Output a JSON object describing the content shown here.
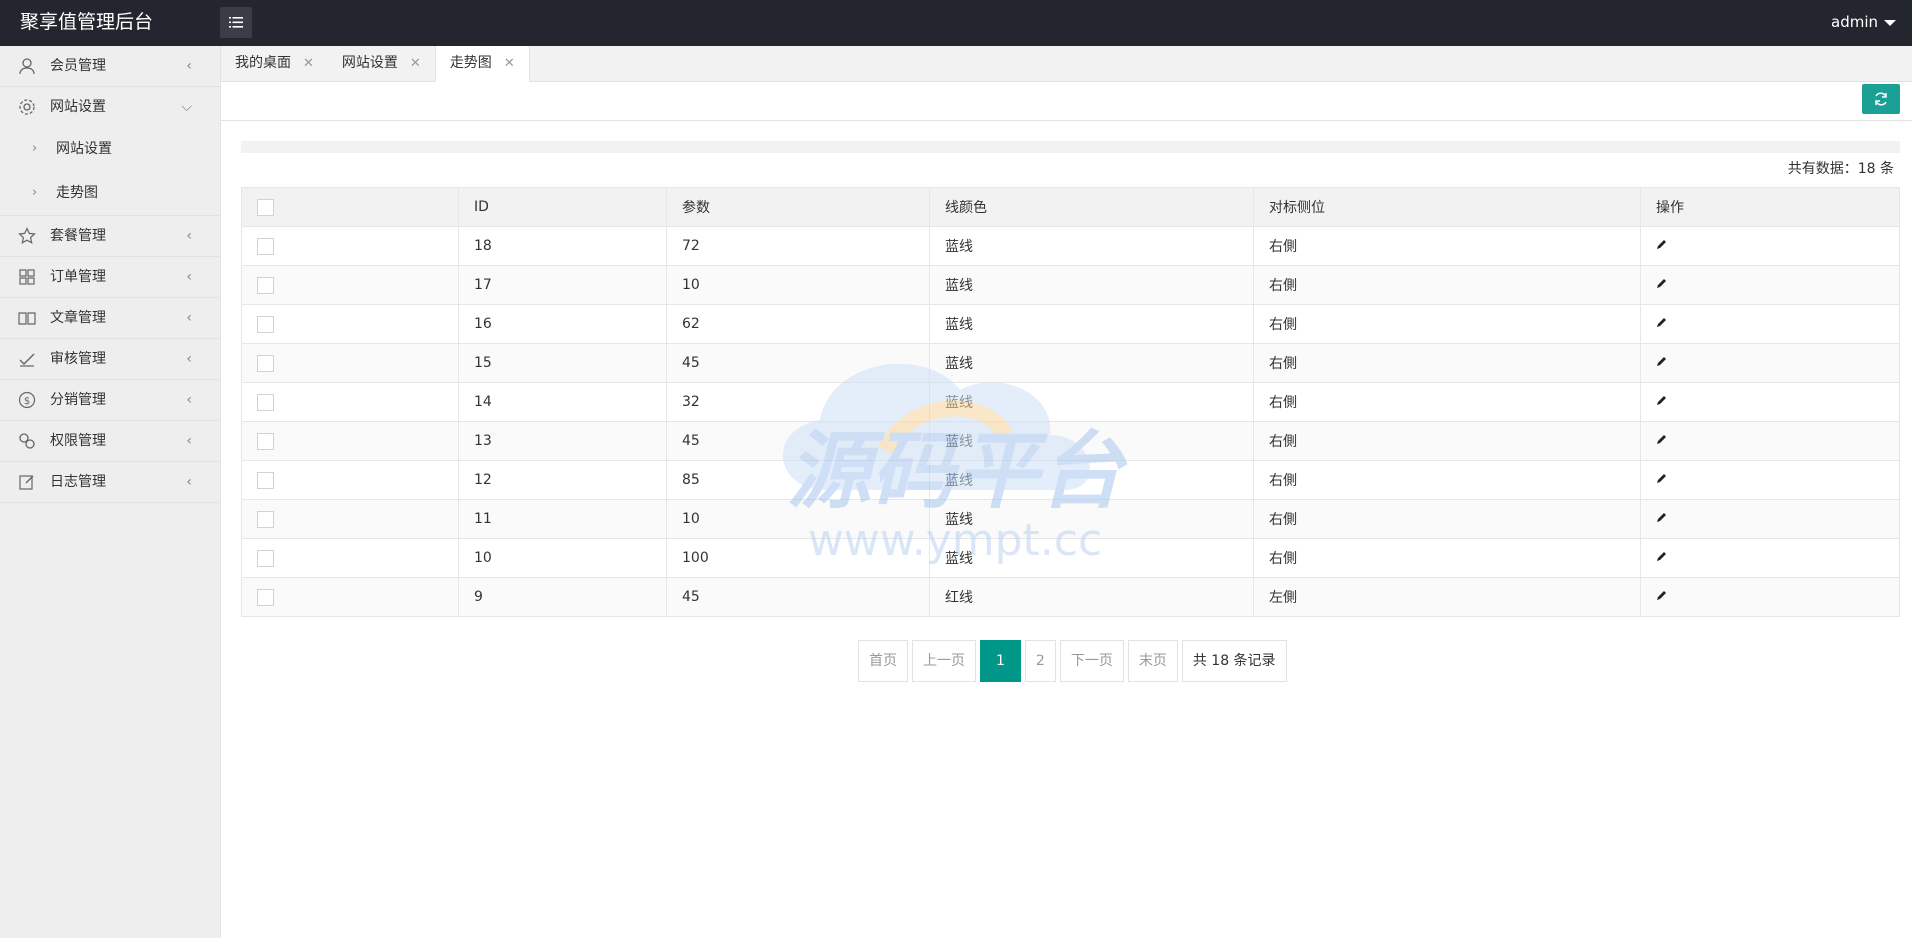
{
  "app": {
    "title": "聚享值管理后台",
    "user": "admin"
  },
  "sidebar": {
    "items": [
      {
        "label": "会员管理"
      },
      {
        "label": "网站设置",
        "sub": [
          "网站设置",
          "走势图"
        ]
      },
      {
        "label": "套餐管理"
      },
      {
        "label": "订单管理"
      },
      {
        "label": "文章管理"
      },
      {
        "label": "审核管理"
      },
      {
        "label": "分销管理"
      },
      {
        "label": "权限管理"
      },
      {
        "label": "日志管理"
      }
    ]
  },
  "tabs": [
    {
      "label": "我的桌面"
    },
    {
      "label": "网站设置"
    },
    {
      "label": "走势图",
      "active": true
    }
  ],
  "summary": {
    "total_text": "共有数据：18 条"
  },
  "table": {
    "headers": [
      "ID",
      "参数",
      "线颜色",
      "对标侧位",
      "操作"
    ],
    "rows": [
      {
        "id": "18",
        "param": "72",
        "color": "蓝线",
        "side": "右側"
      },
      {
        "id": "17",
        "param": "10",
        "color": "蓝线",
        "side": "右側"
      },
      {
        "id": "16",
        "param": "62",
        "color": "蓝线",
        "side": "右側"
      },
      {
        "id": "15",
        "param": "45",
        "color": "蓝线",
        "side": "右側"
      },
      {
        "id": "14",
        "param": "32",
        "color": "蓝线",
        "side": "右側"
      },
      {
        "id": "13",
        "param": "45",
        "color": "蓝线",
        "side": "右側"
      },
      {
        "id": "12",
        "param": "85",
        "color": "蓝线",
        "side": "右側"
      },
      {
        "id": "11",
        "param": "10",
        "color": "蓝线",
        "side": "右側"
      },
      {
        "id": "10",
        "param": "100",
        "color": "蓝线",
        "side": "右側"
      },
      {
        "id": "9",
        "param": "45",
        "color": "红线",
        "side": "左側"
      }
    ]
  },
  "pagination": {
    "first": "首页",
    "prev": "上一页",
    "pages": [
      "1",
      "2"
    ],
    "current": "1",
    "next": "下一页",
    "last": "末页",
    "summary": "共 18 条记录"
  },
  "watermark": {
    "text": "源码平台",
    "url": "www.ympt.cc"
  },
  "colors": {
    "header_bg": "#23262e",
    "accent": "#009688",
    "refresh_btn": "#1aa094"
  }
}
